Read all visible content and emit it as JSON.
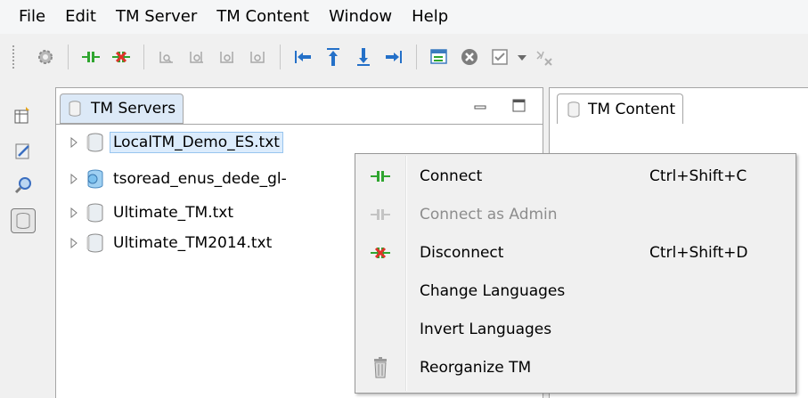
{
  "menubar": {
    "items": [
      "File",
      "Edit",
      "TM Server",
      "TM Content",
      "Window",
      "Help"
    ]
  },
  "toolbar": {
    "buttons": [
      "settings-icon",
      "connect-icon",
      "disconnect-icon",
      "search-icon",
      "search-icon",
      "search-icon",
      "search-icon",
      "first-icon",
      "up-icon",
      "down-icon",
      "last-icon",
      "import-icon",
      "cancel-icon",
      "checkbox-icon",
      "dropdown-icon",
      "clear-icon"
    ]
  },
  "servers_view": {
    "tab_label": "TM Servers",
    "nodes": [
      {
        "label": "LocalTM_Demo_ES.txt",
        "selected": true
      },
      {
        "label": "tsoread_enus_dede_gl-",
        "selected": false
      },
      {
        "label": "Ultimate_TM.txt",
        "selected": false
      },
      {
        "label": "Ultimate_TM2014.txt",
        "selected": false
      }
    ]
  },
  "content_view": {
    "tab_label": "TM Content"
  },
  "context_menu": {
    "items": [
      {
        "label": "Connect",
        "shortcut": "Ctrl+Shift+C",
        "enabled": true,
        "icon": "connect-icon"
      },
      {
        "label": "Connect as Admin",
        "shortcut": "",
        "enabled": false,
        "icon": "connect-icon"
      },
      {
        "label": "Disconnect",
        "shortcut": "Ctrl+Shift+D",
        "enabled": true,
        "icon": "disconnect-icon"
      },
      {
        "label": "Change Languages",
        "shortcut": "",
        "enabled": true,
        "icon": ""
      },
      {
        "label": "Invert Languages",
        "shortcut": "",
        "enabled": true,
        "icon": ""
      },
      {
        "label": "Reorganize TM",
        "shortcut": "",
        "enabled": true,
        "icon": "trash-icon"
      }
    ]
  },
  "colors": {
    "selection_bg": "#dcecfc",
    "selection_border": "#98c5ef",
    "connect_green": "#2fa52f",
    "disconnect_red": "#e0342a"
  }
}
